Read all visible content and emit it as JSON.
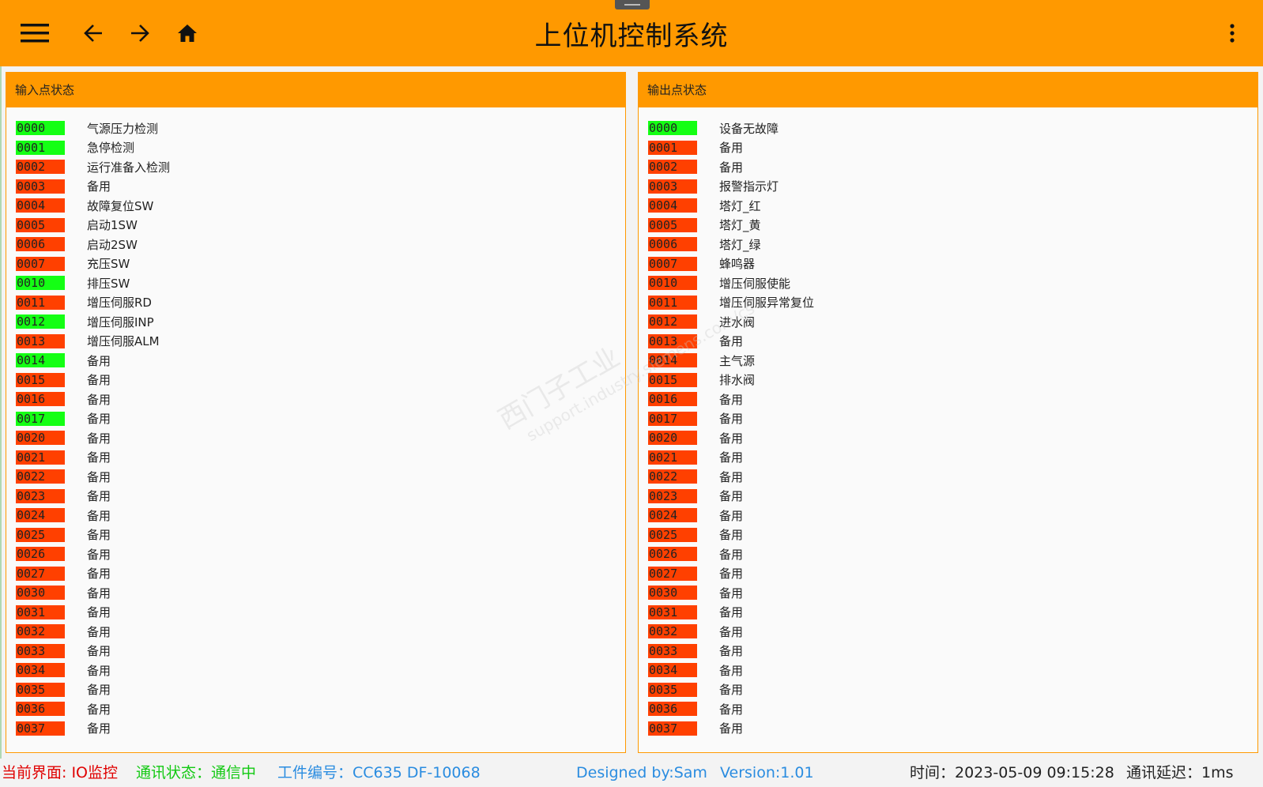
{
  "app": {
    "title": "上位机控制系统"
  },
  "colors": {
    "accent": "#ff9900",
    "on": "#14ff14",
    "off": "#ff4000"
  },
  "toolbar": {
    "menu_icon": "hamburger-icon",
    "back_icon": "arrow-left-icon",
    "forward_icon": "arrow-right-icon",
    "home_icon": "home-icon",
    "more_icon": "more-vert-icon"
  },
  "input_panel": {
    "title": "输入点状态",
    "items": [
      {
        "code": "0000",
        "label": "气源压力检测",
        "on": true
      },
      {
        "code": "0001",
        "label": "急停检测",
        "on": true
      },
      {
        "code": "0002",
        "label": "运行准备入检测",
        "on": false
      },
      {
        "code": "0003",
        "label": "备用",
        "on": false
      },
      {
        "code": "0004",
        "label": "故障复位SW",
        "on": false
      },
      {
        "code": "0005",
        "label": "启动1SW",
        "on": false
      },
      {
        "code": "0006",
        "label": "启动2SW",
        "on": false
      },
      {
        "code": "0007",
        "label": "充压SW",
        "on": false
      },
      {
        "code": "0010",
        "label": "排压SW",
        "on": true
      },
      {
        "code": "0011",
        "label": "增压伺服RD",
        "on": false
      },
      {
        "code": "0012",
        "label": "增压伺服INP",
        "on": true
      },
      {
        "code": "0013",
        "label": "增压伺服ALM",
        "on": false
      },
      {
        "code": "0014",
        "label": "备用",
        "on": true
      },
      {
        "code": "0015",
        "label": "备用",
        "on": false
      },
      {
        "code": "0016",
        "label": "备用",
        "on": false
      },
      {
        "code": "0017",
        "label": "备用",
        "on": true
      },
      {
        "code": "0020",
        "label": "备用",
        "on": false
      },
      {
        "code": "0021",
        "label": "备用",
        "on": false
      },
      {
        "code": "0022",
        "label": "备用",
        "on": false
      },
      {
        "code": "0023",
        "label": "备用",
        "on": false
      },
      {
        "code": "0024",
        "label": "备用",
        "on": false
      },
      {
        "code": "0025",
        "label": "备用",
        "on": false
      },
      {
        "code": "0026",
        "label": "备用",
        "on": false
      },
      {
        "code": "0027",
        "label": "备用",
        "on": false
      },
      {
        "code": "0030",
        "label": "备用",
        "on": false
      },
      {
        "code": "0031",
        "label": "备用",
        "on": false
      },
      {
        "code": "0032",
        "label": "备用",
        "on": false
      },
      {
        "code": "0033",
        "label": "备用",
        "on": false
      },
      {
        "code": "0034",
        "label": "备用",
        "on": false
      },
      {
        "code": "0035",
        "label": "备用",
        "on": false
      },
      {
        "code": "0036",
        "label": "备用",
        "on": false
      },
      {
        "code": "0037",
        "label": "备用",
        "on": false
      }
    ]
  },
  "output_panel": {
    "title": "输出点状态",
    "items": [
      {
        "code": "0000",
        "label": "设备无故障",
        "on": true
      },
      {
        "code": "0001",
        "label": "备用",
        "on": false
      },
      {
        "code": "0002",
        "label": "备用",
        "on": false
      },
      {
        "code": "0003",
        "label": "报警指示灯",
        "on": false
      },
      {
        "code": "0004",
        "label": "塔灯_红",
        "on": false
      },
      {
        "code": "0005",
        "label": "塔灯_黄",
        "on": false
      },
      {
        "code": "0006",
        "label": "塔灯_绿",
        "on": false
      },
      {
        "code": "0007",
        "label": "蜂鸣器",
        "on": false
      },
      {
        "code": "0010",
        "label": "增压伺服使能",
        "on": false
      },
      {
        "code": "0011",
        "label": "增压伺服异常复位",
        "on": false
      },
      {
        "code": "0012",
        "label": "进水阀",
        "on": false
      },
      {
        "code": "0013",
        "label": "备用",
        "on": false
      },
      {
        "code": "0014",
        "label": "主气源",
        "on": false
      },
      {
        "code": "0015",
        "label": "排水阀",
        "on": false
      },
      {
        "code": "0016",
        "label": "备用",
        "on": false
      },
      {
        "code": "0017",
        "label": "备用",
        "on": false
      },
      {
        "code": "0020",
        "label": "备用",
        "on": false
      },
      {
        "code": "0021",
        "label": "备用",
        "on": false
      },
      {
        "code": "0022",
        "label": "备用",
        "on": false
      },
      {
        "code": "0023",
        "label": "备用",
        "on": false
      },
      {
        "code": "0024",
        "label": "备用",
        "on": false
      },
      {
        "code": "0025",
        "label": "备用",
        "on": false
      },
      {
        "code": "0026",
        "label": "备用",
        "on": false
      },
      {
        "code": "0027",
        "label": "备用",
        "on": false
      },
      {
        "code": "0030",
        "label": "备用",
        "on": false
      },
      {
        "code": "0031",
        "label": "备用",
        "on": false
      },
      {
        "code": "0032",
        "label": "备用",
        "on": false
      },
      {
        "code": "0033",
        "label": "备用",
        "on": false
      },
      {
        "code": "0034",
        "label": "备用",
        "on": false
      },
      {
        "code": "0035",
        "label": "备用",
        "on": false
      },
      {
        "code": "0036",
        "label": "备用",
        "on": false
      },
      {
        "code": "0037",
        "label": "备用",
        "on": false
      }
    ]
  },
  "watermark": {
    "line1": "西门子工业",
    "line2": "support.industry.siemens.com/cs"
  },
  "status": {
    "current_page": "当前界面: IO监控",
    "comm_status": "通讯状态：通信中",
    "workpiece": "工件编号：CC635 DF-10068",
    "designer": "Designed by:Sam",
    "version": "Version:1.01",
    "time": "时间：2023-05-09 09:15:28",
    "latency": "通讯延迟：1ms"
  }
}
